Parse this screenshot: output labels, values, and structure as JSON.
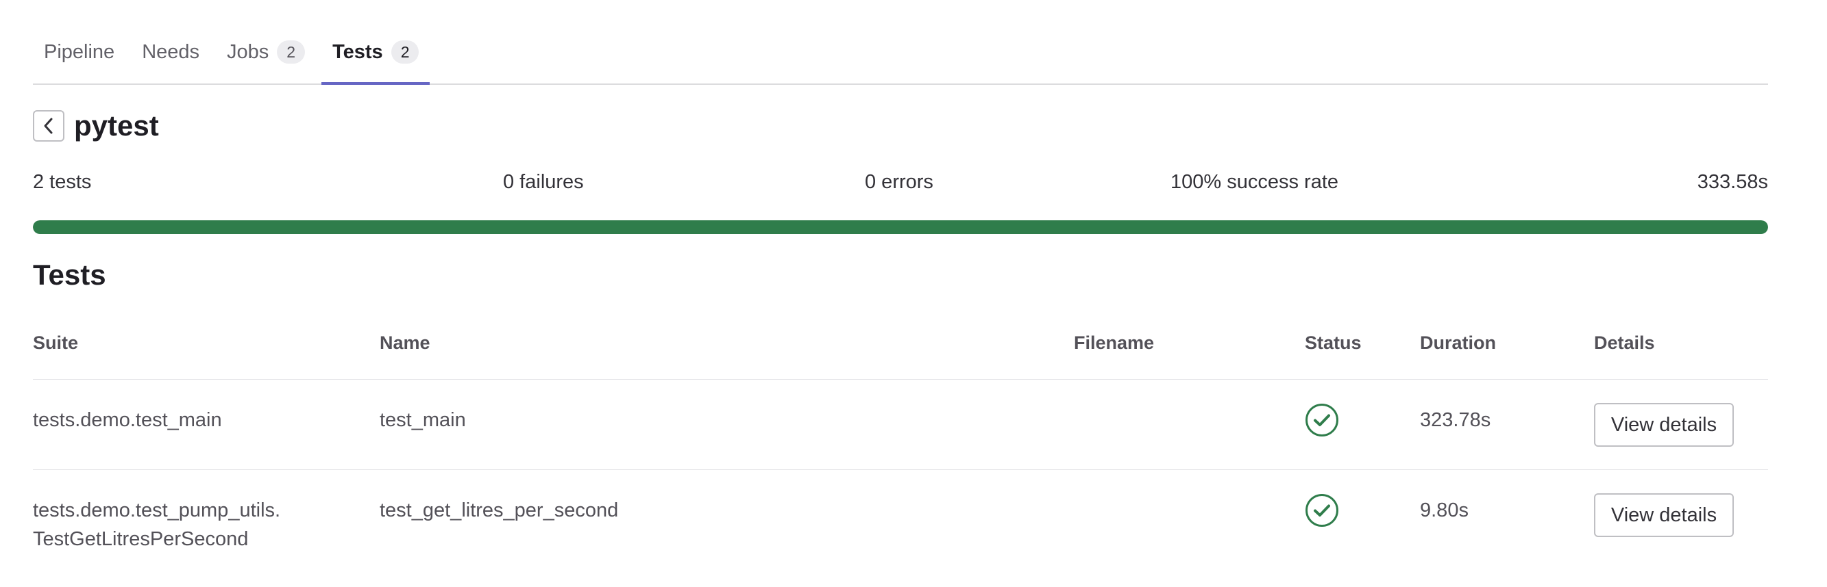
{
  "tabs": [
    {
      "label": "Pipeline"
    },
    {
      "label": "Needs"
    },
    {
      "label": "Jobs",
      "count": "2"
    },
    {
      "label": "Tests",
      "count": "2",
      "active": true
    }
  ],
  "header": {
    "title": "pytest",
    "back_icon": "chevron-left-icon"
  },
  "summary": {
    "tests": "2 tests",
    "failures": "0 failures",
    "errors": "0 errors",
    "success_rate": "100% success rate",
    "duration": "333.58s",
    "progress_fraction": 1.0,
    "progress_color": "#2f7d4b"
  },
  "tests_section": {
    "heading": "Tests",
    "columns": {
      "suite": "Suite",
      "name": "Name",
      "filename": "Filename",
      "status": "Status",
      "duration": "Duration",
      "details": "Details"
    },
    "rows": [
      {
        "suite_line1": "tests.demo.test_main",
        "suite_line2": "",
        "name": "test_main",
        "filename": "",
        "status": "success",
        "status_icon": "check-circle-icon",
        "duration": "323.78s",
        "details_label": "View details"
      },
      {
        "suite_line1": "tests.demo.test_pump_utils.",
        "suite_line2": "TestGetLitresPerSecond",
        "name": "test_get_litres_per_second",
        "filename": "",
        "status": "success",
        "status_icon": "check-circle-icon",
        "duration": "9.80s",
        "details_label": "View details"
      }
    ]
  },
  "colors": {
    "success": "#2f7d4b",
    "tab_active_underline": "#6666c4"
  }
}
